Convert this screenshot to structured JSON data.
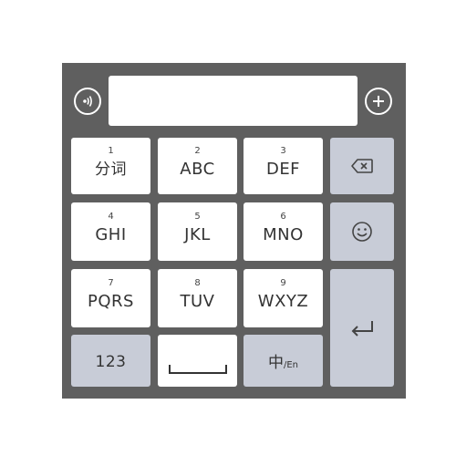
{
  "toolbar": {
    "voice_icon": "voice-wave-icon",
    "add_icon": "plus-circle-icon",
    "input_value": ""
  },
  "keys": {
    "row1": [
      {
        "num": "1",
        "label": "分词"
      },
      {
        "num": "2",
        "label": "ABC"
      },
      {
        "num": "3",
        "label": "DEF"
      }
    ],
    "row2": [
      {
        "num": "4",
        "label": "GHI"
      },
      {
        "num": "5",
        "label": "JKL"
      },
      {
        "num": "6",
        "label": "MNO"
      }
    ],
    "row3": [
      {
        "num": "7",
        "label": "PQRS"
      },
      {
        "num": "8",
        "label": "TUV"
      },
      {
        "num": "9",
        "label": "WXYZ"
      }
    ],
    "bottom": {
      "num_switch": "123",
      "space_icon": "space-bar-icon",
      "lang_main": "中",
      "lang_sep": "/",
      "lang_sub": "En"
    },
    "side": {
      "backspace_icon": "backspace-icon",
      "emoji_icon": "smiley-icon",
      "enter_icon": "enter-icon"
    }
  },
  "colors": {
    "panel": "#5f5f5f",
    "key": "#ffffff",
    "function_key": "#c8ccd7"
  }
}
